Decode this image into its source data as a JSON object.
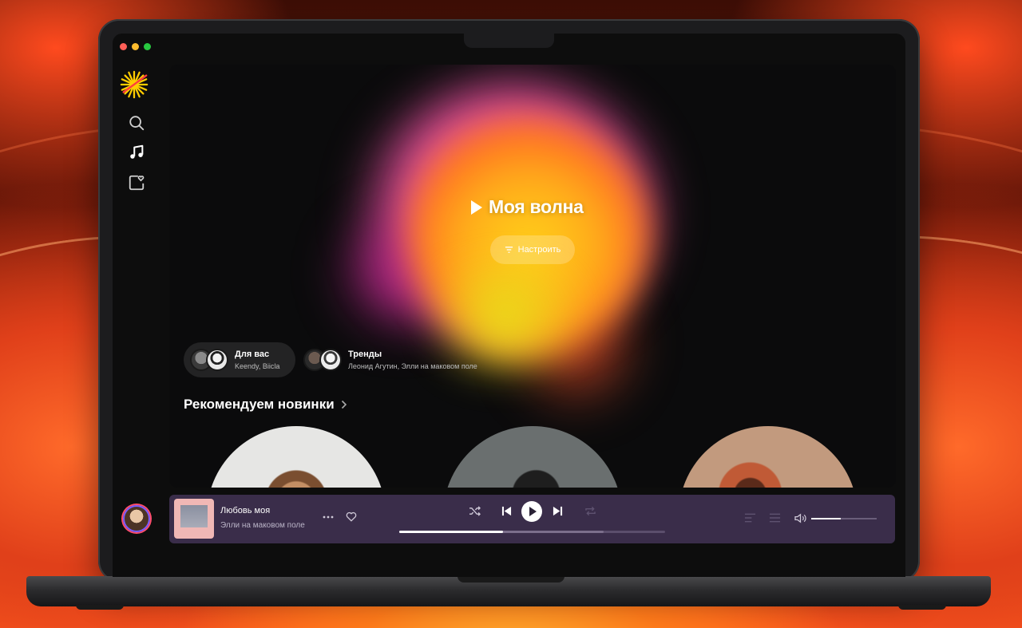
{
  "window": {
    "traffic_lights": {
      "close": "#ff5f57",
      "minimize": "#febc2e",
      "maximize": "#28c840"
    }
  },
  "sidebar": {
    "logo_icon": "yandex-music-sun-icon",
    "items": [
      {
        "icon": "search-icon"
      },
      {
        "icon": "music-note-icon"
      },
      {
        "icon": "collection-heart-icon"
      }
    ],
    "avatar_icon": "user-avatar"
  },
  "hero": {
    "title": "Моя волна",
    "tune_button_label": "Настроить",
    "accent_colors": [
      "#ffd21a",
      "#ff6a22",
      "#e24d9e"
    ]
  },
  "mixes": [
    {
      "title": "Для вас",
      "subtitle": "Keendy, Biicla"
    },
    {
      "title": "Тренды",
      "subtitle": "Леонид Агутин, Элли на маковом поле"
    }
  ],
  "recommend": {
    "title": "Рекомендуем новинки",
    "covers": 3
  },
  "player": {
    "track_title": "Любовь моя",
    "track_artist": "Элли на маковом поле",
    "progress_fraction": 0.39,
    "buffered_fraction": 0.77,
    "volume_fraction": 0.45,
    "background": "#3a2d4a"
  }
}
